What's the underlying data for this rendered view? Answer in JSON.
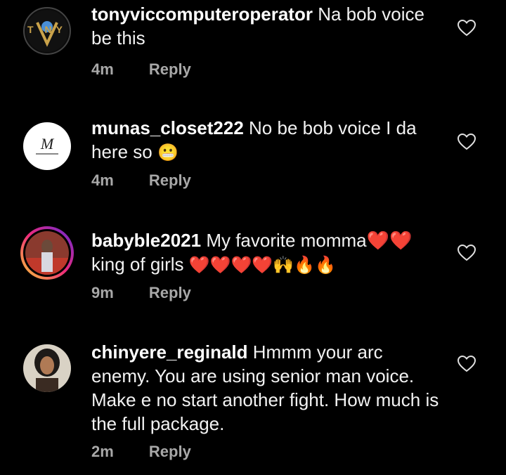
{
  "comments": [
    {
      "username": "tonyviccomputeroperator",
      "text": "Na bob voice be this",
      "time": "4m",
      "reply_label": "Reply",
      "avatar_text": "T NY"
    },
    {
      "username": "munas_closet222",
      "text": "No be bob voice I da here so",
      "emoji": "😬",
      "time": "4m",
      "reply_label": "Reply",
      "avatar_text": "M"
    },
    {
      "username": "babyble2021",
      "text": "My favorite momma❤️❤️ king of girls",
      "emoji": "❤️❤️❤️❤️🙌🔥🔥",
      "time": "9m",
      "reply_label": "Reply"
    },
    {
      "username": "chinyere_reginald",
      "text": "Hmmm your arc enemy. You are using senior man voice. Make e no start another fight. How much is the full package.",
      "time": "2m",
      "reply_label": "Reply"
    }
  ],
  "colors": {
    "background": "#000000",
    "meta": "#a8a8a8",
    "story_ring": "#e1306c"
  }
}
